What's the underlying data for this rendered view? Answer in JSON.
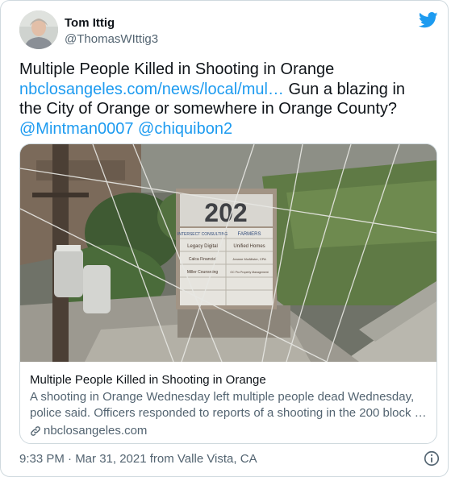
{
  "author": {
    "name": "Tom Ittig",
    "handle": "@ThomasWIttig3"
  },
  "tweet": {
    "text_line1": "Multiple People Killed in Shooting in Orange",
    "link": "nbclosangeles.com/news/local/mul…",
    "text_after_link": " Gun a blazing in the City of Orange or somewhere in Orange County?",
    "mention1": "@Mintman0007",
    "mention2": "@chiquibon2"
  },
  "card": {
    "sign_number": "202",
    "sign_rows": [
      [
        "Legacy Digital",
        "Unified Homes"
      ],
      [
        "Calca Financial",
        "Jeanne McAllister, CPA"
      ],
      [
        "Miller Counseling",
        "OC Pro Property Management"
      ]
    ],
    "sign_brand_left": "INTERSECT CONSULTING",
    "sign_brand_right": "FARMERS",
    "title": "Multiple People Killed in Shooting in Orange",
    "description": "A shooting in Orange Wednesday left multiple people dead Wednesday, police said. Officers responded to reports of a shooting in the 200 block …",
    "domain": "nbclosangeles.com"
  },
  "meta": {
    "timestamp": "9:33 PM · Mar 31, 2021 from Valle Vista, CA"
  },
  "colors": {
    "link": "#1d9bf0",
    "secondary_text": "#536471",
    "border": "#cfd9de"
  },
  "icons": [
    "twitter-bird-icon",
    "link-icon",
    "info-icon"
  ]
}
